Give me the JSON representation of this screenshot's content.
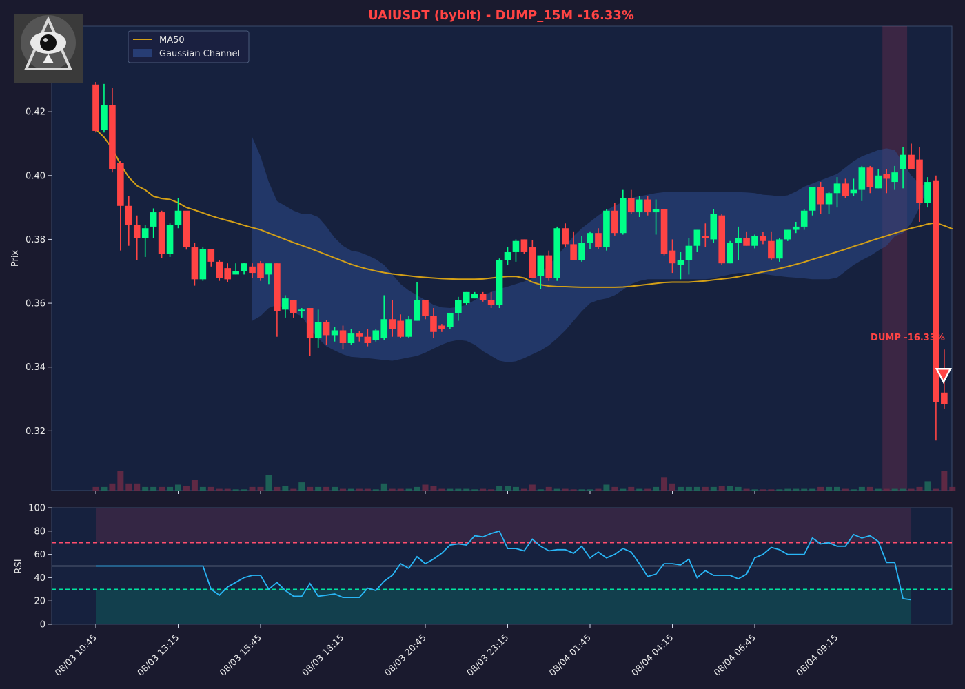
{
  "title": "UAIUSDT (bybit) - DUMP_15M -16.33%",
  "colors": {
    "background": "#1a1a2e",
    "panel": "#16213e",
    "title": "#ff4444",
    "bull": "#00ff88",
    "bear": "#ff4444",
    "ma": "#d4a017",
    "channel": "#2d4a8a",
    "rsi_line": "#29b6f6",
    "overbought": "#ff4d6d",
    "oversold": "#00e5a0"
  },
  "legend": {
    "ma_label": "MA50",
    "channel_label": "Gaussian Channel"
  },
  "logo": {
    "icon": "eye-pyramid-logo"
  },
  "dump_annotation": {
    "text": "DUMP -16.33%",
    "price": 0.3375,
    "icon": "down-triangle-marker"
  },
  "chart_data": [
    {
      "type": "candlestick",
      "ylabel": "Prix",
      "ylim": [
        0.3013,
        0.4468
      ],
      "yticks": [
        0.32,
        0.34,
        0.36,
        0.38,
        0.4,
        0.42
      ],
      "ytick_labels": [
        "0.32",
        "0.34",
        "0.36",
        "0.38",
        "0.40",
        "0.42"
      ],
      "xtick_labels": [
        "08/03 10:45",
        "08/03 13:15",
        "08/03 15:45",
        "08/03 18:15",
        "08/03 20:45",
        "08/03 23:15",
        "08/04 01:45",
        "08/04 04:15",
        "08/04 06:45",
        "08/04 09:15"
      ],
      "xtick_index": [
        0,
        10,
        20,
        30,
        40,
        50,
        60,
        70,
        80,
        90
      ],
      "highlight_range": [
        96,
        98
      ],
      "candles": [
        [
          0.4285,
          0.4293,
          0.4135,
          0.414
        ],
        [
          0.4142,
          0.4287,
          0.4135,
          0.422
        ],
        [
          0.422,
          0.4275,
          0.401,
          0.402
        ],
        [
          0.404,
          0.4045,
          0.3765,
          0.3905
        ],
        [
          0.3905,
          0.3935,
          0.378,
          0.3845
        ],
        [
          0.3845,
          0.3875,
          0.3735,
          0.3805
        ],
        [
          0.3805,
          0.3845,
          0.3745,
          0.3835
        ],
        [
          0.384,
          0.3897,
          0.3805,
          0.3885
        ],
        [
          0.3885,
          0.389,
          0.3742,
          0.3755
        ],
        [
          0.3755,
          0.385,
          0.3745,
          0.3845
        ],
        [
          0.3845,
          0.393,
          0.3835,
          0.389
        ],
        [
          0.389,
          0.3889,
          0.3768,
          0.3775
        ],
        [
          0.3775,
          0.379,
          0.3655,
          0.3675
        ],
        [
          0.3675,
          0.3775,
          0.367,
          0.377
        ],
        [
          0.377,
          0.3768,
          0.3715,
          0.373
        ],
        [
          0.373,
          0.3735,
          0.367,
          0.368
        ],
        [
          0.371,
          0.3725,
          0.3665,
          0.3675
        ],
        [
          0.369,
          0.3725,
          0.369,
          0.37
        ],
        [
          0.37,
          0.3727,
          0.369,
          0.3725
        ],
        [
          0.3715,
          0.3725,
          0.368,
          0.3695
        ],
        [
          0.3725,
          0.3732,
          0.367,
          0.368
        ],
        [
          0.369,
          0.3723,
          0.366,
          0.3725
        ],
        [
          0.3725,
          0.3725,
          0.3495,
          0.3575
        ],
        [
          0.358,
          0.3625,
          0.3555,
          0.3615
        ],
        [
          0.361,
          0.3605,
          0.3555,
          0.357
        ],
        [
          0.3575,
          0.3585,
          0.3555,
          0.358
        ],
        [
          0.3585,
          0.3582,
          0.3435,
          0.349
        ],
        [
          0.349,
          0.358,
          0.346,
          0.354
        ],
        [
          0.354,
          0.3547,
          0.347,
          0.35
        ],
        [
          0.35,
          0.3525,
          0.348,
          0.3515
        ],
        [
          0.3515,
          0.353,
          0.3455,
          0.3475
        ],
        [
          0.3475,
          0.352,
          0.347,
          0.3505
        ],
        [
          0.3505,
          0.3512,
          0.348,
          0.3495
        ],
        [
          0.3495,
          0.352,
          0.3465,
          0.3475
        ],
        [
          0.3485,
          0.352,
          0.348,
          0.3515
        ],
        [
          0.349,
          0.3625,
          0.3485,
          0.355
        ],
        [
          0.355,
          0.361,
          0.3495,
          0.352
        ],
        [
          0.3545,
          0.3565,
          0.349,
          0.3495
        ],
        [
          0.3495,
          0.356,
          0.3492,
          0.355
        ],
        [
          0.3545,
          0.3665,
          0.3545,
          0.361
        ],
        [
          0.361,
          0.361,
          0.355,
          0.356
        ],
        [
          0.356,
          0.3585,
          0.349,
          0.351
        ],
        [
          0.353,
          0.3535,
          0.351,
          0.352
        ],
        [
          0.3525,
          0.357,
          0.352,
          0.357
        ],
        [
          0.357,
          0.362,
          0.3545,
          0.361
        ],
        [
          0.36,
          0.3635,
          0.3595,
          0.3635
        ],
        [
          0.3615,
          0.3635,
          0.3615,
          0.363
        ],
        [
          0.363,
          0.3635,
          0.3605,
          0.361
        ],
        [
          0.361,
          0.3635,
          0.3585,
          0.3595
        ],
        [
          0.3595,
          0.374,
          0.3585,
          0.3735
        ],
        [
          0.3735,
          0.3775,
          0.372,
          0.376
        ],
        [
          0.376,
          0.38,
          0.373,
          0.3795
        ],
        [
          0.38,
          0.38,
          0.3755,
          0.376
        ],
        [
          0.3775,
          0.3797,
          0.369,
          0.368
        ],
        [
          0.3685,
          0.375,
          0.3645,
          0.375
        ],
        [
          0.375,
          0.3765,
          0.367,
          0.368
        ],
        [
          0.368,
          0.384,
          0.367,
          0.3835
        ],
        [
          0.3835,
          0.385,
          0.3775,
          0.3785
        ],
        [
          0.3785,
          0.3825,
          0.3735,
          0.3735
        ],
        [
          0.3735,
          0.381,
          0.373,
          0.379
        ],
        [
          0.379,
          0.3825,
          0.377,
          0.382
        ],
        [
          0.382,
          0.3835,
          0.377,
          0.3775
        ],
        [
          0.3775,
          0.3895,
          0.3765,
          0.389
        ],
        [
          0.389,
          0.3915,
          0.3812,
          0.382
        ],
        [
          0.382,
          0.3955,
          0.3815,
          0.393
        ],
        [
          0.393,
          0.3955,
          0.388,
          0.3885
        ],
        [
          0.3885,
          0.3935,
          0.387,
          0.3925
        ],
        [
          0.3925,
          0.3935,
          0.3875,
          0.3885
        ],
        [
          0.3885,
          0.3925,
          0.3815,
          0.3895
        ],
        [
          0.3895,
          0.3895,
          0.375,
          0.3755
        ],
        [
          0.3765,
          0.38,
          0.3695,
          0.3725
        ],
        [
          0.372,
          0.376,
          0.3675,
          0.3735
        ],
        [
          0.3735,
          0.3805,
          0.369,
          0.378
        ],
        [
          0.378,
          0.383,
          0.376,
          0.383
        ],
        [
          0.381,
          0.385,
          0.3775,
          0.3805
        ],
        [
          0.38,
          0.3895,
          0.379,
          0.388
        ],
        [
          0.3875,
          0.388,
          0.372,
          0.3725
        ],
        [
          0.3725,
          0.3795,
          0.3725,
          0.379
        ],
        [
          0.379,
          0.384,
          0.3735,
          0.3805
        ],
        [
          0.3805,
          0.3825,
          0.378,
          0.378
        ],
        [
          0.378,
          0.3815,
          0.3772,
          0.381
        ],
        [
          0.381,
          0.3823,
          0.3785,
          0.3795
        ],
        [
          0.3795,
          0.3825,
          0.3735,
          0.374
        ],
        [
          0.374,
          0.3805,
          0.373,
          0.38
        ],
        [
          0.38,
          0.383,
          0.3795,
          0.383
        ],
        [
          0.383,
          0.3855,
          0.382,
          0.384
        ],
        [
          0.384,
          0.3895,
          0.383,
          0.389
        ],
        [
          0.389,
          0.395,
          0.3875,
          0.3965
        ],
        [
          0.3965,
          0.398,
          0.388,
          0.391
        ],
        [
          0.391,
          0.395,
          0.388,
          0.3945
        ],
        [
          0.3945,
          0.3995,
          0.39,
          0.3975
        ],
        [
          0.3975,
          0.399,
          0.393,
          0.3935
        ],
        [
          0.3945,
          0.399,
          0.3935,
          0.3955
        ],
        [
          0.3955,
          0.403,
          0.392,
          0.4025
        ],
        [
          0.4025,
          0.403,
          0.3945,
          0.3965
        ],
        [
          0.396,
          0.402,
          0.396,
          0.4
        ],
        [
          0.4005,
          0.402,
          0.3945,
          0.399
        ],
        [
          0.398,
          0.403,
          0.3955,
          0.401
        ],
        [
          0.402,
          0.409,
          0.396,
          0.4065
        ],
        [
          0.4065,
          0.41,
          0.4025,
          0.402
        ],
        [
          0.405,
          0.409,
          0.3855,
          0.3915
        ],
        [
          0.3915,
          0.3995,
          0.39,
          0.398
        ],
        [
          0.3985,
          0.4,
          0.317,
          0.329
        ],
        [
          0.332,
          0.3455,
          0.327,
          0.3285
        ]
      ],
      "ma50": [
        0.4145,
        0.412,
        0.4085,
        0.4035,
        0.3995,
        0.3968,
        0.3955,
        0.3935,
        0.3928,
        0.3925,
        0.3915,
        0.39,
        0.3892,
        0.3883,
        0.3874,
        0.3866,
        0.3859,
        0.3852,
        0.3844,
        0.3837,
        0.383,
        0.382,
        0.381,
        0.38,
        0.379,
        0.3781,
        0.3772,
        0.3762,
        0.3752,
        0.3742,
        0.3732,
        0.3722,
        0.3714,
        0.3707,
        0.3701,
        0.3696,
        0.3692,
        0.3689,
        0.3686,
        0.3683,
        0.3681,
        0.3679,
        0.3677,
        0.3676,
        0.3675,
        0.3675,
        0.3675,
        0.3676,
        0.3679,
        0.3682,
        0.3684,
        0.3684,
        0.3679,
        0.3666,
        0.3658,
        0.3654,
        0.3652,
        0.3652,
        0.3651,
        0.365,
        0.365,
        0.365,
        0.365,
        0.365,
        0.3651,
        0.3653,
        0.3656,
        0.3659,
        0.3662,
        0.3665,
        0.3666,
        0.3666,
        0.3666,
        0.3668,
        0.367,
        0.3673,
        0.3676,
        0.3679,
        0.3683,
        0.3688,
        0.3693,
        0.3698,
        0.3703,
        0.3709,
        0.3715,
        0.3722,
        0.3729,
        0.3737,
        0.3745,
        0.3753,
        0.3761,
        0.3769,
        0.3778,
        0.3786,
        0.3795,
        0.3803,
        0.3811,
        0.3819,
        0.3828,
        0.3835,
        0.3841,
        0.3848,
        0.3852,
        0.3843,
        0.3833
      ],
      "channel_start": 19,
      "channel_upper": [
        0.412,
        0.406,
        0.398,
        0.392,
        0.3905,
        0.389,
        0.388,
        0.388,
        0.387,
        0.384,
        0.3805,
        0.378,
        0.3765,
        0.376,
        0.375,
        0.3738,
        0.372,
        0.369,
        0.366,
        0.364,
        0.3625,
        0.361,
        0.3595,
        0.3587,
        0.3585,
        0.3588,
        0.3595,
        0.361,
        0.3625,
        0.3635,
        0.3645,
        0.3652,
        0.366,
        0.3668,
        0.3678,
        0.3695,
        0.372,
        0.3748,
        0.3778,
        0.381,
        0.3835,
        0.3855,
        0.3875,
        0.3892,
        0.3905,
        0.3918,
        0.393,
        0.3935,
        0.394,
        0.3945,
        0.3948,
        0.395,
        0.395,
        0.395,
        0.395,
        0.395,
        0.395,
        0.395,
        0.395,
        0.3948,
        0.3947,
        0.3945,
        0.394,
        0.3938,
        0.3935,
        0.3938,
        0.395,
        0.3965,
        0.3975,
        0.3985,
        0.3995,
        0.4005,
        0.4025,
        0.4045,
        0.406,
        0.407,
        0.408,
        0.4085,
        0.408,
        0.404,
        0.4,
        0.3975,
        0.3965
      ],
      "channel_lower": [
        0.3545,
        0.356,
        0.3585,
        0.3595,
        0.3585,
        0.357,
        0.356,
        0.352,
        0.349,
        0.3465,
        0.3452,
        0.344,
        0.3432,
        0.343,
        0.3428,
        0.3425,
        0.3422,
        0.342,
        0.3425,
        0.343,
        0.3435,
        0.3445,
        0.3458,
        0.347,
        0.348,
        0.3485,
        0.3482,
        0.347,
        0.345,
        0.3435,
        0.342,
        0.3415,
        0.3418,
        0.3428,
        0.344,
        0.3452,
        0.3468,
        0.349,
        0.3515,
        0.3545,
        0.3575,
        0.36,
        0.361,
        0.3615,
        0.3625,
        0.3642,
        0.366,
        0.367,
        0.3675,
        0.3675,
        0.3675,
        0.3675,
        0.3675,
        0.3675,
        0.3675,
        0.3675,
        0.3678,
        0.3685,
        0.369,
        0.3695,
        0.3695,
        0.3695,
        0.3692,
        0.3688,
        0.3685,
        0.3682,
        0.368,
        0.3678,
        0.3675,
        0.3675,
        0.3675,
        0.368,
        0.37,
        0.372,
        0.3735,
        0.3748,
        0.3765,
        0.378,
        0.381,
        0.382,
        0.385,
        0.39,
        0.396
      ],
      "volume_ylim": [
        0,
        100
      ],
      "volume": [
        3,
        3,
        6,
        17,
        6,
        6,
        3,
        3,
        3,
        3,
        5,
        4,
        9,
        3,
        3,
        2,
        2,
        1,
        1,
        3,
        3,
        13,
        3,
        4,
        2,
        7,
        3,
        3,
        3,
        3,
        2,
        2,
        2,
        2,
        1,
        6,
        2,
        2,
        2,
        3,
        5,
        4,
        2,
        2,
        2,
        2,
        1,
        2,
        1,
        4,
        4,
        3,
        2,
        5,
        1,
        3,
        2,
        2,
        1,
        1,
        1,
        2,
        5,
        3,
        2,
        3,
        2,
        2,
        3,
        11,
        6,
        3,
        3,
        3,
        3,
        3,
        4,
        4,
        3,
        2,
        1,
        1,
        1,
        1,
        2,
        2,
        2,
        2,
        3,
        3,
        3,
        2,
        1,
        3,
        3,
        2,
        2,
        2,
        2,
        2,
        3,
        8,
        2,
        17,
        3
      ],
      "dump_index": 102
    },
    {
      "type": "line",
      "ylabel": "RSI",
      "ylim": [
        0,
        100
      ],
      "yticks": [
        0,
        20,
        40,
        60,
        80,
        100
      ],
      "ytick_labels": [
        "0",
        "20",
        "40",
        "60",
        "80",
        "100"
      ],
      "overbought": 70,
      "oversold": 30,
      "midline": 50,
      "rsi": [
        50,
        50,
        50,
        50,
        50,
        50,
        50,
        50,
        50,
        50,
        50,
        50,
        50,
        50,
        30,
        25,
        32,
        36,
        40,
        42,
        42,
        30,
        36,
        29,
        24,
        24,
        35,
        24,
        25,
        26,
        23,
        23,
        23,
        31,
        29,
        37,
        42,
        52,
        48,
        58,
        52,
        56,
        61,
        68,
        69,
        68,
        76,
        75,
        78,
        80,
        65,
        65,
        63,
        73,
        67,
        63,
        64,
        64,
        61,
        67,
        57,
        62,
        57,
        60,
        65,
        62,
        52,
        41,
        43,
        52,
        52,
        51,
        56,
        40,
        46,
        42,
        42,
        42,
        39,
        43,
        57,
        60,
        66,
        64,
        60,
        60,
        60,
        74,
        69,
        70,
        67,
        67,
        77,
        74,
        76,
        71,
        53,
        53,
        22,
        21
      ],
      "rsi_end_index": 99
    }
  ]
}
